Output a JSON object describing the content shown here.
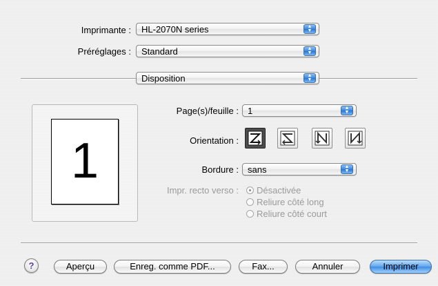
{
  "printer": {
    "label": "Imprimante :",
    "value": "HL-2070N series"
  },
  "presets": {
    "label": "Préréglages :",
    "value": "Standard"
  },
  "panel": {
    "value": "Disposition"
  },
  "preview": {
    "page_number": "1"
  },
  "layout": {
    "pages_per_sheet": {
      "label": "Page(s)/feuille :",
      "value": "1"
    },
    "orientation": {
      "label": "Orientation :",
      "selected_index": 0,
      "options": [
        "z-left-right-icon",
        "s-right-left-icon",
        "n-vertical-left-icon",
        "n-vertical-right-icon"
      ]
    },
    "border": {
      "label": "Bordure :",
      "value": "sans"
    },
    "duplex": {
      "label": "Impr. recto verso :",
      "options": [
        {
          "label": "Désactivée",
          "selected": true
        },
        {
          "label": "Reliure côté long",
          "selected": false
        },
        {
          "label": "Reliure côté court",
          "selected": false
        }
      ]
    }
  },
  "buttons": {
    "help": "?",
    "preview": "Aperçu",
    "save_pdf": "Enreg. comme PDF...",
    "fax": "Fax...",
    "cancel": "Annuler",
    "print": "Imprimer"
  },
  "colors": {
    "accent": "#3d8de4",
    "disabled_text": "#9a9a9a"
  }
}
